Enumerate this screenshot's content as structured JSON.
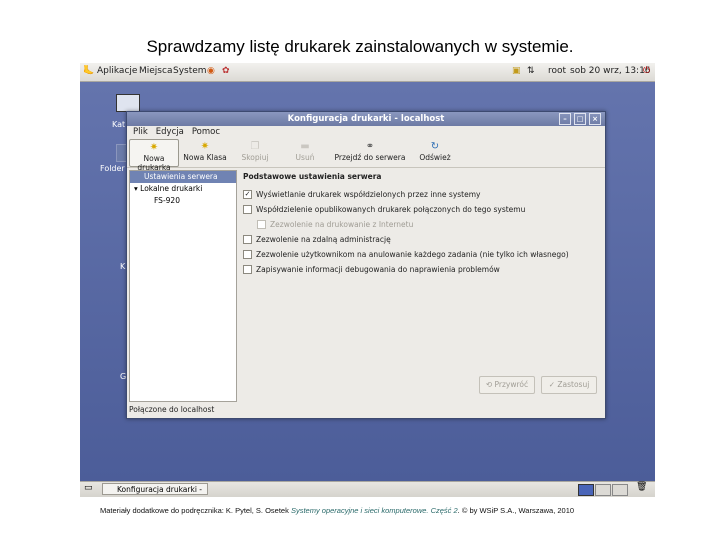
{
  "slide": {
    "title": "Sprawdzamy listę drukarek zainstalowanych w systemie.",
    "footer_prefix": "Materiały dodatkowe do podręcznika: K. Pytel, S. Osetek ",
    "footer_book": "Systemy operacyjne i sieci komputerowe. Część 2",
    "footer_suffix": ". © by WSiP S.A., Warszawa, 2010"
  },
  "top_panel": {
    "menus": [
      "Aplikacje",
      "Miejsca",
      "System"
    ],
    "user": "root",
    "clock": "sob 20 wrz, 13:16"
  },
  "desktop": {
    "icons": [
      "Kat",
      "Folder",
      "K",
      "G"
    ]
  },
  "window": {
    "title": "Konfiguracja drukarki - localhost",
    "menubar": [
      "Plik",
      "Edycja",
      "Pomoc"
    ],
    "toolbar": [
      {
        "label": "Nowa drukarka",
        "icon": "new-printer-icon",
        "state": "active"
      },
      {
        "label": "Nowa Klasa",
        "icon": "new-class-icon",
        "state": "normal"
      },
      {
        "label": "Skopiuj",
        "icon": "copy-icon",
        "state": "disabled"
      },
      {
        "label": "Usuń",
        "icon": "delete-icon",
        "state": "disabled"
      },
      {
        "label": "Przejdź do serwera",
        "icon": "connect-icon",
        "state": "normal"
      },
      {
        "label": "Odśwież",
        "icon": "refresh-icon",
        "state": "normal"
      }
    ],
    "tree": {
      "server_settings": "Ustawienia serwera",
      "local_printers": "Lokalne drukarki",
      "printer": "FS-920"
    },
    "section_title": "Podstawowe ustawienia serwera",
    "options": [
      {
        "label": "Wyświetlanie drukarek współdzielonych przez inne systemy",
        "checked": true,
        "enabled": true
      },
      {
        "label": "Współdzielenie opublikowanych drukarek połączonych do tego systemu",
        "checked": false,
        "enabled": true
      },
      {
        "label": "Zezwolenie na drukowanie z Internetu",
        "checked": false,
        "enabled": false
      },
      {
        "label": "Zezwolenie na zdalną administrację",
        "checked": false,
        "enabled": true
      },
      {
        "label": "Zezwolenie użytkownikom na anulowanie każdego zadania (nie tylko ich własnego)",
        "checked": false,
        "enabled": true
      },
      {
        "label": "Zapisywanie informacji debugowania do naprawienia problemów",
        "checked": false,
        "enabled": true
      }
    ],
    "buttons": {
      "revert": "Przywróć",
      "apply": "Zastosuj"
    },
    "status": "Połączone do localhost"
  },
  "bottom_panel": {
    "task": "Konfiguracja drukarki - ..."
  },
  "colors": {
    "desktop": "#5b6ea8",
    "selection": "#7083b3",
    "titlebar": "#7a87b0"
  }
}
